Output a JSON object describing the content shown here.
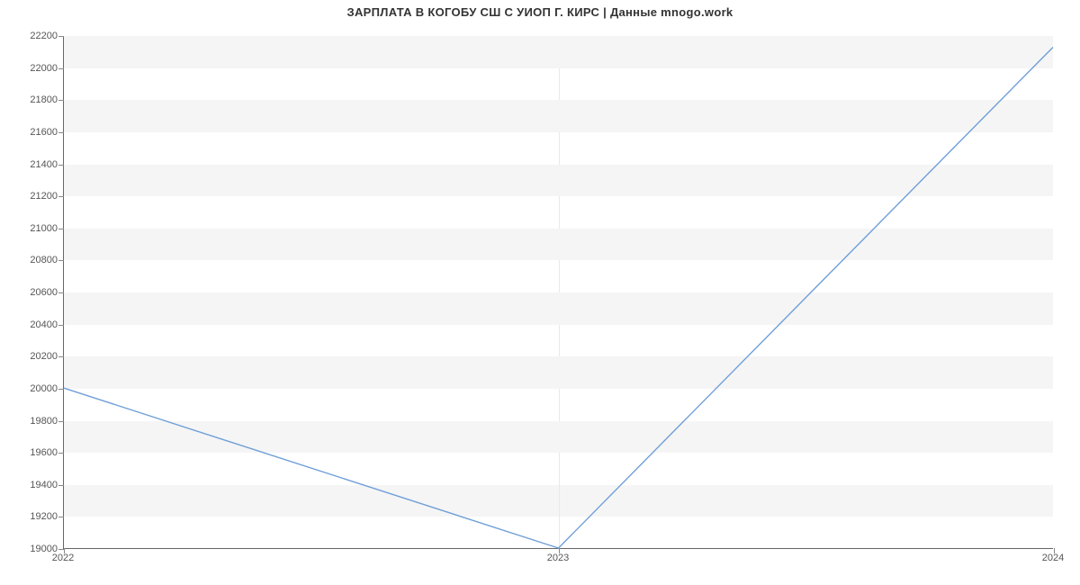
{
  "chart_data": {
    "type": "line",
    "title": "ЗАРПЛАТА В КОГОБУ СШ С УИОП Г. КИРС | Данные mnogo.work",
    "x": [
      "2022",
      "2023",
      "2024"
    ],
    "values": [
      20000,
      19000,
      22130
    ],
    "xlabel": "",
    "ylabel": "",
    "ylim": [
      19000,
      22200
    ],
    "y_ticks": [
      19000,
      19200,
      19400,
      19600,
      19800,
      20000,
      20200,
      20400,
      20600,
      20800,
      21000,
      21200,
      21400,
      21600,
      21800,
      22000,
      22200
    ],
    "colors": {
      "line": "#6f9fd8",
      "band": "#f5f5f5"
    }
  }
}
